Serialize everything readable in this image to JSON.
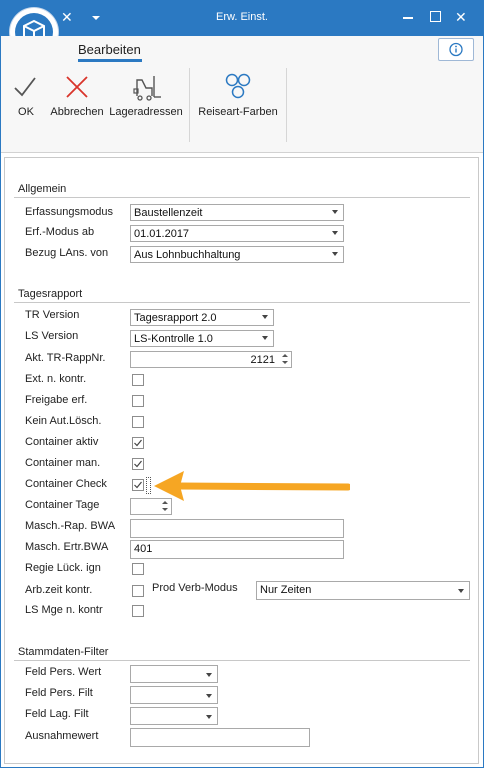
{
  "window": {
    "title": "Erw. Einst."
  },
  "ribbon": {
    "tab": "Bearbeiten",
    "buttons": {
      "ok": "OK",
      "cancel": "Abbrechen",
      "storage": "Lageradressen",
      "travel": "Reiseart-Farben"
    }
  },
  "allgemein": {
    "title": "Allgemein",
    "erfassungsmodus": {
      "label": "Erfassungsmodus",
      "value": "Baustellenzeit"
    },
    "erf_modus_ab": {
      "label": "Erf.-Modus ab",
      "value": "01.01.2017"
    },
    "bezug": {
      "label": "Bezug LAns. von",
      "value": "Aus Lohnbuchhaltung"
    }
  },
  "tagesrapport": {
    "title": "Tagesrapport",
    "tr_version": {
      "label": "TR Version",
      "value": "Tagesrapport 2.0"
    },
    "ls_version": {
      "label": "LS Version",
      "value": "LS-Kontrolle 1.0"
    },
    "akt_tr": {
      "label": "Akt. TR-RappNr.",
      "value": "2121"
    },
    "ext_kontr": {
      "label": "Ext. n. kontr.",
      "checked": false
    },
    "freigabe": {
      "label": "Freigabe erf.",
      "checked": false
    },
    "kein_aut": {
      "label": "Kein Aut.Lösch.",
      "checked": false
    },
    "container_aktiv": {
      "label": "Container aktiv",
      "checked": true
    },
    "container_man": {
      "label": "Container man.",
      "checked": true
    },
    "container_check": {
      "label": "Container Check",
      "checked": true
    },
    "container_tage": {
      "label": "Container Tage",
      "value": ""
    },
    "masch_rap": {
      "label": "Masch.-Rap. BWA",
      "value": ""
    },
    "masch_ertr": {
      "label": "Masch. Ertr.BWA",
      "value": "401"
    },
    "regie": {
      "label": "Regie Lück. ign",
      "checked": false
    },
    "arbzeit": {
      "label": "Arb.zeit kontr.",
      "checked": false
    },
    "prod_verb": {
      "label": "Prod Verb-Modus",
      "value": "Nur Zeiten"
    },
    "ls_mge": {
      "label": "LS Mge n. kontr",
      "checked": false
    }
  },
  "stammdaten": {
    "title": "Stammdaten-Filter",
    "feld_pers_wert": {
      "label": "Feld Pers. Wert",
      "value": ""
    },
    "feld_pers_filt": {
      "label": "Feld Pers. Filt",
      "value": ""
    },
    "feld_lag_filt": {
      "label": "Feld Lag. Filt",
      "value": ""
    },
    "ausnahmewert": {
      "label": "Ausnahmewert",
      "value": ""
    }
  },
  "colors": {
    "accent": "#2b79c2",
    "cancel": "#d9342b",
    "arrow": "#f6a623",
    "reiseart": "#2b79c2"
  }
}
